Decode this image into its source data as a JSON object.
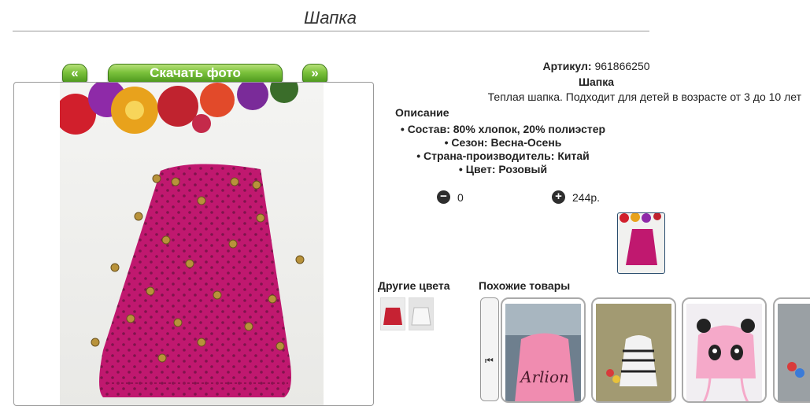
{
  "page": {
    "title": "Шапка"
  },
  "gallery": {
    "prev_label": "«",
    "download_label": "Скачать фото",
    "next_label": "»"
  },
  "product": {
    "sku_label": "Артикул:",
    "sku_value": "961866250",
    "name": "Шапка",
    "description": "Теплая шапка. Подходит для детей в возрасте от 3 до 10 лет",
    "description_heading": "Описание",
    "properties": [
      "Состав: 80% хлопок, 20% полиэстер",
      "Сезон: Весна-Осень",
      "Страна-производитель: Китай",
      "Цвет: Розовый"
    ],
    "quantity": "0",
    "price": "244р."
  },
  "sections": {
    "other_colors": "Другие цвета",
    "similar": "Похожие товары"
  },
  "colors": {
    "primary": "#c0186f",
    "button_green": "#6db534",
    "frame_border": "#999999"
  },
  "similar_items": [
    {
      "caption": "Arlion"
    },
    {
      "caption": ""
    },
    {
      "caption": ""
    },
    {
      "caption": ""
    }
  ]
}
